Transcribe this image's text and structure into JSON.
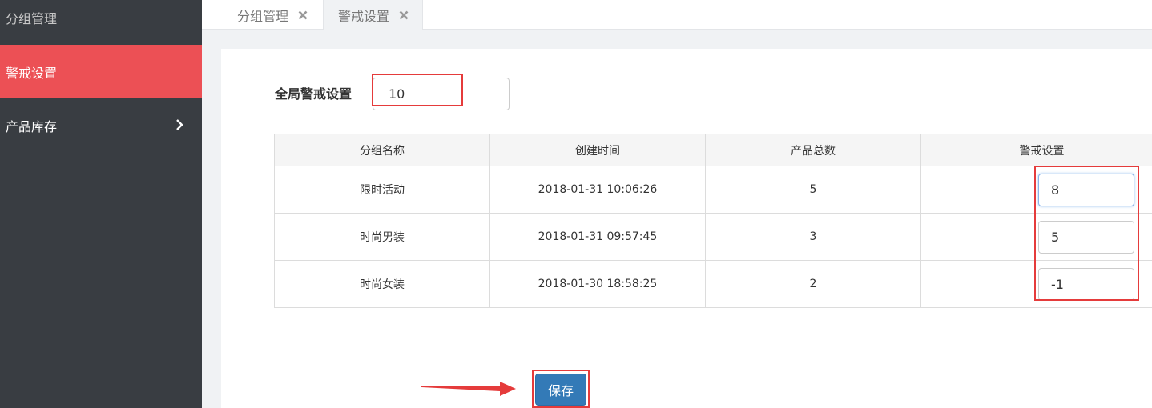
{
  "sidebar": {
    "items": [
      {
        "label": "分组管理"
      },
      {
        "label": "警戒设置"
      },
      {
        "label": "产品库存"
      }
    ]
  },
  "tabs": [
    {
      "label": "分组管理"
    },
    {
      "label": "警戒设置"
    }
  ],
  "global_warning": {
    "label": "全局警戒设置",
    "value": "10"
  },
  "table": {
    "headers": [
      "分组名称",
      "创建时间",
      "产品总数",
      "警戒设置"
    ],
    "rows": [
      {
        "name": "限时活动",
        "created": "2018-01-31 10:06:26",
        "total": "5",
        "warning": "8"
      },
      {
        "name": "时尚男装",
        "created": "2018-01-31 09:57:45",
        "total": "3",
        "warning": "5"
      },
      {
        "name": "时尚女装",
        "created": "2018-01-30 18:58:25",
        "total": "2",
        "warning": "-1"
      }
    ]
  },
  "save_label": "保存",
  "colors": {
    "sidebar_bg": "#393d42",
    "sidebar_active": "#ec5055",
    "primary_button": "#337ab7",
    "annotation_red": "#e53b3b"
  }
}
